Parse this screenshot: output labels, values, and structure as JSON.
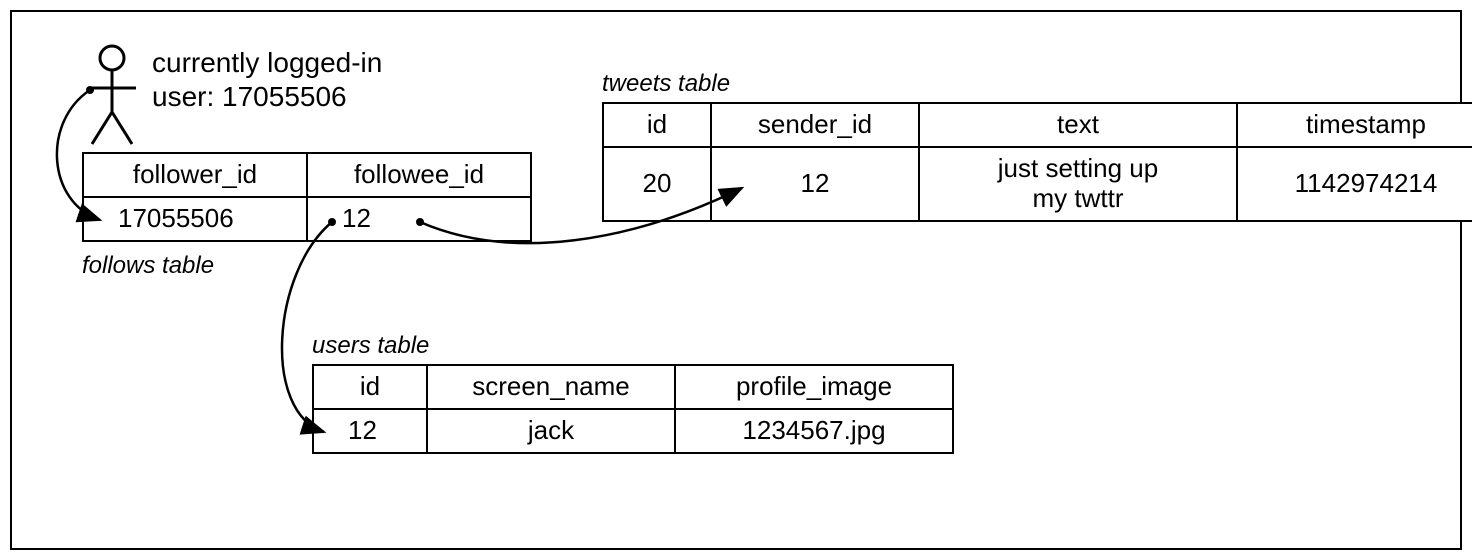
{
  "user_label_line1": "currently logged-in",
  "user_label_line2": "user: 17055506",
  "follows": {
    "caption": "follows table",
    "headers": [
      "follower_id",
      "followee_id"
    ],
    "row": [
      "17055506",
      "12"
    ]
  },
  "tweets": {
    "caption": "tweets table",
    "headers": [
      "id",
      "sender_id",
      "text",
      "timestamp"
    ],
    "row": [
      "20",
      "12",
      "just setting up\nmy twttr",
      "1142974214"
    ]
  },
  "users": {
    "caption": "users table",
    "headers": [
      "id",
      "screen_name",
      "profile_image"
    ],
    "row": [
      "12",
      "jack",
      "1234567.jpg"
    ]
  }
}
